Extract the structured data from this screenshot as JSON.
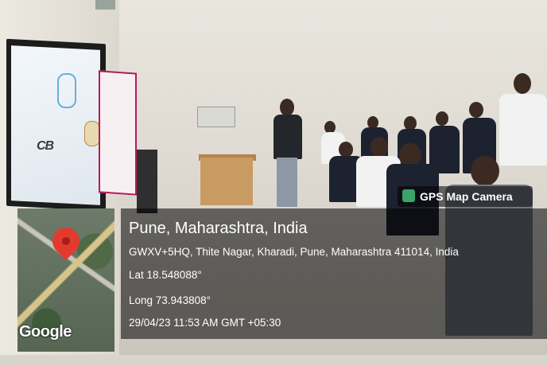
{
  "gps_overlay": {
    "app_badge": "GPS Map Camera",
    "location_title": "Pune, Maharashtra, India",
    "address": "GWXV+5HQ, Thite Nagar, Kharadi, Pune, Maharashtra 411014, India",
    "latitude": "Lat 18.548088°",
    "longitude": "Long 73.943808°",
    "timestamp": "29/04/23 11:53 AM GMT +05:30",
    "map_provider": "Google"
  },
  "screen": {
    "logo_text": "CB"
  },
  "colors": {
    "overlay_bg": "#000000",
    "pin": "#e23a2f",
    "badge_icon": "#3ca36a"
  },
  "icons": [
    "map-pin-icon",
    "gps-camera-icon"
  ]
}
